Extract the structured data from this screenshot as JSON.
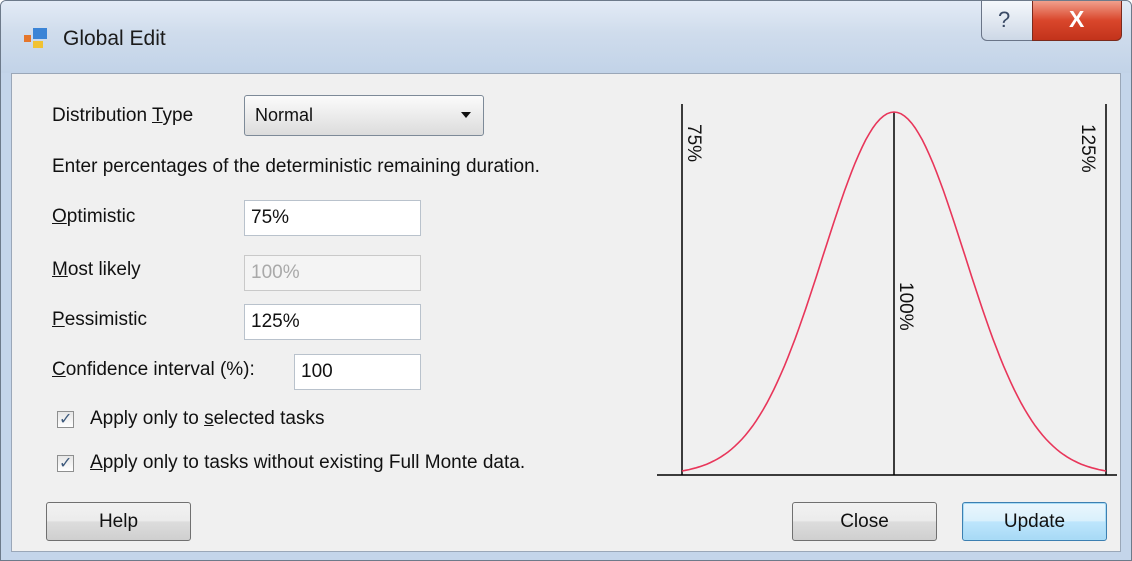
{
  "window": {
    "title": "Global Edit",
    "help_glyph": "?",
    "close_glyph": "X"
  },
  "distribution": {
    "label_prefix": "Distribution ",
    "label_accel": "T",
    "label_suffix": "ype",
    "selected": "Normal"
  },
  "instructions": "Enter percentages of the deterministic remaining duration.",
  "fields": {
    "optimistic": {
      "label_accel": "O",
      "label_rest": "ptimistic",
      "value": "75%"
    },
    "most_likely": {
      "label_accel": "M",
      "label_rest": "ost likely",
      "value": "100%"
    },
    "pessimistic": {
      "label_accel": "P",
      "label_rest": "essimistic",
      "value": "125%"
    },
    "confidence": {
      "label_accel": "C",
      "label_rest": "onfidence interval (%):",
      "value": "100"
    }
  },
  "checkboxes": {
    "selected_tasks": {
      "pre": "Apply only to ",
      "accel": "s",
      "post": "elected tasks",
      "checked": true
    },
    "without_data": {
      "pre": "",
      "accel": "A",
      "post": "pply only to tasks without existing Full Monte data.",
      "checked": true
    }
  },
  "buttons": {
    "help": "Help",
    "close": "Close",
    "update": "Update"
  },
  "chart_data": {
    "type": "line",
    "series": [
      {
        "values": "normal-distribution-curve",
        "color": "#e8365a"
      }
    ],
    "x_markers": [
      {
        "label": "75%",
        "position": 75
      },
      {
        "label": "100%",
        "position": 100
      },
      {
        "label": "125%",
        "position": 125
      }
    ],
    "xlim": [
      75,
      125
    ]
  }
}
